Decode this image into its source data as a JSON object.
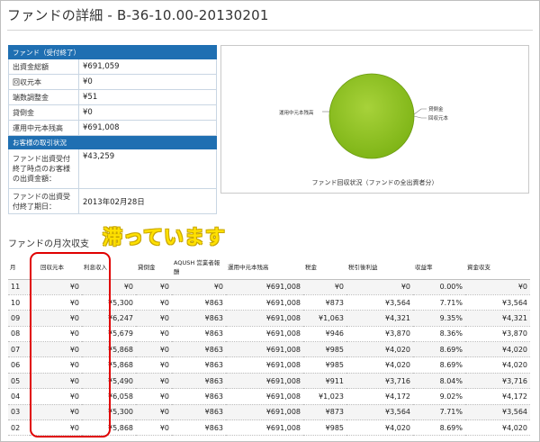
{
  "page_title": "ファンドの詳細 - B-36-10.00-20130201",
  "fund_info": {
    "header": "ファンド（受付終了）",
    "rows": [
      {
        "label": "出資金総額",
        "value": "¥691,059"
      },
      {
        "label": "回収元本",
        "value": "¥0"
      },
      {
        "label": "端数調整金",
        "value": "¥51"
      },
      {
        "label": "貸倒金",
        "value": "¥0"
      },
      {
        "label": "運用中元本残高",
        "value": "¥691,008"
      }
    ],
    "customer_header": "お客様の取引状況",
    "customer_rows": [
      {
        "label": "ファンド出資受付終了時点のお客様の出資金額：",
        "value": "¥43,259"
      },
      {
        "label": "ファンドの出資受付終了期日：",
        "value": "2013年02月28日"
      }
    ]
  },
  "pie": {
    "caption": "ファンド回収状況（ファンドの全出資者分）",
    "labels": {
      "main": "運用中元本残高",
      "loss": "貸倒金",
      "recovered": "回収元本"
    },
    "color": "#8fc31f"
  },
  "annotation": "滞っています",
  "monthly": {
    "title": "ファンドの月次収支",
    "headers": [
      "月",
      "回収元本",
      "利息収入",
      "貸倒金",
      "AQUSH 営業者報酬",
      "運用中元本残高",
      "税金",
      "税引後利益",
      "収益率",
      "資金収支"
    ],
    "rows": [
      [
        "11",
        "¥0",
        "¥0",
        "¥0",
        "¥0",
        "¥691,008",
        "¥0",
        "¥0",
        "0.00%",
        "¥0"
      ],
      [
        "10",
        "¥0",
        "¥5,300",
        "¥0",
        "¥863",
        "¥691,008",
        "¥873",
        "¥3,564",
        "7.71%",
        "¥3,564"
      ],
      [
        "09",
        "¥0",
        "¥6,247",
        "¥0",
        "¥863",
        "¥691,008",
        "¥1,063",
        "¥4,321",
        "9.35%",
        "¥4,321"
      ],
      [
        "08",
        "¥0",
        "¥5,679",
        "¥0",
        "¥863",
        "¥691,008",
        "¥946",
        "¥3,870",
        "8.36%",
        "¥3,870"
      ],
      [
        "07",
        "¥0",
        "¥5,868",
        "¥0",
        "¥863",
        "¥691,008",
        "¥985",
        "¥4,020",
        "8.69%",
        "¥4,020"
      ],
      [
        "06",
        "¥0",
        "¥5,868",
        "¥0",
        "¥863",
        "¥691,008",
        "¥985",
        "¥4,020",
        "8.69%",
        "¥4,020"
      ],
      [
        "05",
        "¥0",
        "¥5,490",
        "¥0",
        "¥863",
        "¥691,008",
        "¥911",
        "¥3,716",
        "8.04%",
        "¥3,716"
      ],
      [
        "04",
        "¥0",
        "¥6,058",
        "¥0",
        "¥863",
        "¥691,008",
        "¥1,023",
        "¥4,172",
        "9.02%",
        "¥4,172"
      ],
      [
        "03",
        "¥0",
        "¥5,300",
        "¥0",
        "¥863",
        "¥691,008",
        "¥873",
        "¥3,564",
        "7.71%",
        "¥3,564"
      ],
      [
        "02",
        "¥0",
        "¥5,868",
        "¥0",
        "¥863",
        "¥691,008",
        "¥985",
        "¥4,020",
        "8.69%",
        "¥4,020"
      ]
    ]
  }
}
